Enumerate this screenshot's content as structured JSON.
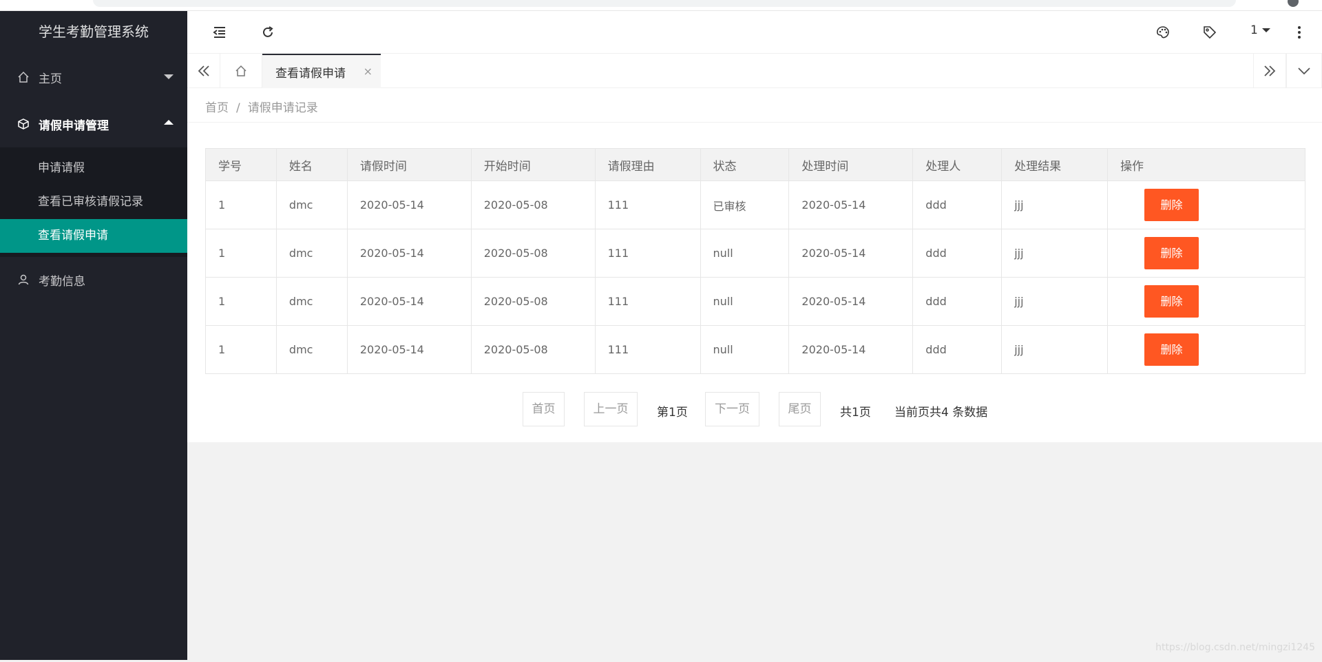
{
  "app": {
    "title": "学生考勤管理系统"
  },
  "sidebar": {
    "items": [
      {
        "label": "主页",
        "icon": "home-icon"
      },
      {
        "label": "请假申请管理",
        "icon": "cube-icon",
        "open": true,
        "children": [
          {
            "label": "申请请假"
          },
          {
            "label": "查看已审核请假记录"
          },
          {
            "label": "查看请假申请",
            "active": true
          }
        ]
      },
      {
        "label": "考勤信息",
        "icon": "user-icon"
      }
    ]
  },
  "header": {
    "user": "1"
  },
  "tabs": {
    "active": {
      "label": "查看请假申请",
      "close": "×"
    }
  },
  "breadcrumb": {
    "home": "首页",
    "separator": "/",
    "current": "请假申请记录"
  },
  "table": {
    "headers": [
      "学号",
      "姓名",
      "请假时间",
      "开始时间",
      "请假理由",
      "状态",
      "处理时间",
      "处理人",
      "处理结果",
      "操作"
    ],
    "rows": [
      [
        "1",
        "dmc",
        "2020-05-14",
        "2020-05-08",
        "111",
        "已审核",
        "2020-05-14",
        "ddd",
        "jjj",
        "删除"
      ],
      [
        "1",
        "dmc",
        "2020-05-14",
        "2020-05-08",
        "111",
        "null",
        "2020-05-14",
        "ddd",
        "jjj",
        "删除"
      ],
      [
        "1",
        "dmc",
        "2020-05-14",
        "2020-05-08",
        "111",
        "null",
        "2020-05-14",
        "ddd",
        "jjj",
        "删除"
      ],
      [
        "1",
        "dmc",
        "2020-05-14",
        "2020-05-08",
        "111",
        "null",
        "2020-05-14",
        "ddd",
        "jjj",
        "删除"
      ]
    ]
  },
  "pager": {
    "first": "首页",
    "prev": "上一页",
    "current": "第1页",
    "next": "下一页",
    "last": "尾页",
    "total_pages": "共1页",
    "summary": "当前页共4 条数据"
  },
  "watermark": "https://blog.csdn.net/mingzi1245",
  "colors": {
    "sidebar": "#20222a",
    "accent": "#009688",
    "danger": "#ff5722"
  }
}
